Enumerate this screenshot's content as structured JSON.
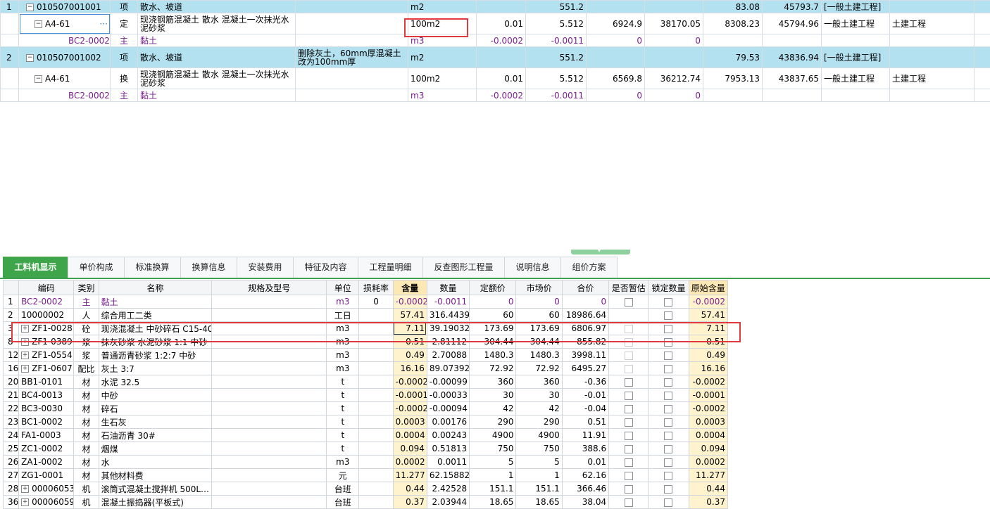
{
  "upper": {
    "rows": [
      {
        "type": "item",
        "hl": true,
        "idx": "1",
        "code": "010507001001",
        "cat": "项",
        "name": "散水、坡道",
        "feature": "",
        "unit": "m2",
        "qty_coef": "",
        "qty": "551.2",
        "price": "",
        "total": "",
        "comp_price": "83.08",
        "comp_total": "45793.7",
        "prof": "[一般土建工程]",
        "spec": ""
      },
      {
        "type": "quota",
        "hl": false,
        "idx": "",
        "code": "A4-61",
        "cat": "定",
        "name": "现浇钢筋混凝土 散水 混凝土一次抹光水泥砂浆",
        "feature": "",
        "unit": "100m2",
        "qty_coef": "0.01",
        "qty": "5.512",
        "price": "6924.9",
        "total": "38170.05",
        "comp_price": "8308.23",
        "comp_total": "45794.96",
        "prof": "一般土建工程",
        "spec": "土建工程"
      },
      {
        "type": "mat",
        "hl": false,
        "idx": "",
        "code": "BC2-0002",
        "cat": "主",
        "name": "黏土",
        "feature": "",
        "unit": "m3",
        "qty_coef": "-0.0002",
        "qty": "-0.0011",
        "price": "0",
        "total": "0",
        "comp_price": "",
        "comp_total": "",
        "prof": "",
        "spec": ""
      },
      {
        "type": "item",
        "hl": true,
        "idx": "2",
        "code": "010507001002",
        "cat": "项",
        "name": "散水、坡道",
        "feature": "删除灰土，60mm厚混凝土改为100mm厚",
        "unit": "m2",
        "qty_coef": "",
        "qty": "551.2",
        "price": "",
        "total": "",
        "comp_price": "79.53",
        "comp_total": "43836.94",
        "prof": "[一般土建工程]",
        "spec": ""
      },
      {
        "type": "quota",
        "hl": false,
        "idx": "",
        "code": "A4-61",
        "cat": "换",
        "name": "现浇钢筋混凝土 散水 混凝土一次抹光水泥砂浆",
        "feature": "",
        "unit": "100m2",
        "qty_coef": "0.01",
        "qty": "5.512",
        "price": "6569.8",
        "total": "36212.74",
        "comp_price": "7953.13",
        "comp_total": "43837.65",
        "prof": "一般土建工程",
        "spec": "土建工程"
      },
      {
        "type": "mat",
        "hl": false,
        "idx": "",
        "code": "BC2-0002",
        "cat": "主",
        "name": "黏土",
        "feature": "",
        "unit": "m3",
        "qty_coef": "-0.0002",
        "qty": "-0.0011",
        "price": "0",
        "total": "0",
        "comp_price": "",
        "comp_total": "",
        "prof": "",
        "spec": ""
      }
    ]
  },
  "tabs": [
    "工料机显示",
    "单价构成",
    "标准换算",
    "换算信息",
    "安装费用",
    "特征及内容",
    "工程量明细",
    "反查图形工程量",
    "说明信息",
    "组价方案"
  ],
  "lower": {
    "headers": [
      "编码",
      "类别",
      "名称",
      "规格及型号",
      "单位",
      "损耗率",
      "含量",
      "数量",
      "定额价",
      "市场价",
      "合价",
      "是否暂估",
      "锁定数量",
      "原始含量"
    ],
    "rows": [
      {
        "rn": "1",
        "code": "BC2-0002",
        "cat": "主",
        "name": "黏土",
        "spec": "",
        "unit": "m3",
        "loss": "0",
        "content": "-0.0002",
        "qty": "-0.0011",
        "qprice": "0",
        "mprice": "0",
        "total": "0",
        "est": "chk",
        "lock": "chk",
        "orig": "-0.0002",
        "purple": true,
        "exp": false
      },
      {
        "rn": "2",
        "code": "10000002",
        "cat": "人",
        "name": "综合用工二类",
        "spec": "",
        "unit": "工日",
        "loss": "",
        "content": "57.41",
        "qty": "316.44392",
        "qprice": "60",
        "mprice": "60",
        "total": "18986.64",
        "est": "",
        "lock": "chk",
        "orig": "57.41",
        "purple": false,
        "exp": false
      },
      {
        "rn": "3",
        "code": "ZF1-0028",
        "cat": "砼",
        "name": "现浇混凝土 中砂碎石 C15-40",
        "spec": "",
        "unit": "m3",
        "loss": "",
        "content": "7.11",
        "qty": "39.19032",
        "qprice": "173.69",
        "mprice": "173.69",
        "total": "6806.97",
        "est": "dim",
        "lock": "chk",
        "orig": "7.11",
        "purple": false,
        "exp": true
      },
      {
        "rn": "8",
        "code": "ZF1-0389",
        "cat": "浆",
        "name": "抹灰砂浆 水泥砂浆 1:1 中砂",
        "spec": "",
        "unit": "m3",
        "loss": "",
        "content": "0.51",
        "qty": "2.81112",
        "qprice": "304.44",
        "mprice": "304.44",
        "total": "855.82",
        "est": "dim",
        "lock": "chk",
        "orig": "0.51",
        "purple": false,
        "exp": true
      },
      {
        "rn": "12",
        "code": "ZF1-0554",
        "cat": "浆",
        "name": "普通沥青砂浆 1:2:7 中砂",
        "spec": "",
        "unit": "m3",
        "loss": "",
        "content": "0.49",
        "qty": "2.70088",
        "qprice": "1480.3",
        "mprice": "1480.3",
        "total": "3998.11",
        "est": "dim",
        "lock": "chk",
        "orig": "0.49",
        "purple": false,
        "exp": true
      },
      {
        "rn": "16",
        "code": "ZF1-0607",
        "cat": "配比",
        "name": "灰土 3:7",
        "spec": "",
        "unit": "m3",
        "loss": "",
        "content": "16.16",
        "qty": "89.07392",
        "qprice": "72.92",
        "mprice": "72.92",
        "total": "6495.27",
        "est": "dim",
        "lock": "chk",
        "orig": "16.16",
        "purple": false,
        "exp": true
      },
      {
        "rn": "20",
        "code": "BB1-0101",
        "cat": "材",
        "name": "水泥 32.5",
        "spec": "",
        "unit": "t",
        "loss": "",
        "content": "-0.0002",
        "qty": "-0.00099",
        "qprice": "360",
        "mprice": "360",
        "total": "-0.36",
        "est": "chk",
        "lock": "chk",
        "orig": "-0.0002",
        "purple": false,
        "exp": false
      },
      {
        "rn": "21",
        "code": "BC4-0013",
        "cat": "材",
        "name": "中砂",
        "spec": "",
        "unit": "t",
        "loss": "",
        "content": "-0.0001",
        "qty": "-0.00033",
        "qprice": "30",
        "mprice": "30",
        "total": "-0.01",
        "est": "chk",
        "lock": "chk",
        "orig": "-0.0001",
        "purple": false,
        "exp": false
      },
      {
        "rn": "22",
        "code": "BC3-0030",
        "cat": "材",
        "name": "碎石",
        "spec": "",
        "unit": "t",
        "loss": "",
        "content": "-0.0002",
        "qty": "-0.00094",
        "qprice": "42",
        "mprice": "42",
        "total": "-0.04",
        "est": "chk",
        "lock": "chk",
        "orig": "-0.0002",
        "purple": false,
        "exp": false
      },
      {
        "rn": "23",
        "code": "BC1-0002",
        "cat": "材",
        "name": "生石灰",
        "spec": "",
        "unit": "t",
        "loss": "",
        "content": "0.0003",
        "qty": "0.00176",
        "qprice": "290",
        "mprice": "290",
        "total": "0.51",
        "est": "chk",
        "lock": "chk",
        "orig": "0.0003",
        "purple": false,
        "exp": false
      },
      {
        "rn": "24",
        "code": "FA1-0003",
        "cat": "材",
        "name": "石油沥青 30#",
        "spec": "",
        "unit": "t",
        "loss": "",
        "content": "0.0004",
        "qty": "0.00243",
        "qprice": "4900",
        "mprice": "4900",
        "total": "11.91",
        "est": "chk",
        "lock": "chk",
        "orig": "0.0004",
        "purple": false,
        "exp": false
      },
      {
        "rn": "25",
        "code": "ZC1-0002",
        "cat": "材",
        "name": "烟煤",
        "spec": "",
        "unit": "t",
        "loss": "",
        "content": "0.094",
        "qty": "0.51813",
        "qprice": "750",
        "mprice": "750",
        "total": "388.6",
        "est": "chk",
        "lock": "chk",
        "orig": "0.094",
        "purple": false,
        "exp": false
      },
      {
        "rn": "26",
        "code": "ZA1-0002",
        "cat": "材",
        "name": "水",
        "spec": "",
        "unit": "m3",
        "loss": "",
        "content": "0.0002",
        "qty": "0.0011",
        "qprice": "5",
        "mprice": "5",
        "total": "0.01",
        "est": "chk",
        "lock": "chk",
        "orig": "0.0002",
        "purple": false,
        "exp": false
      },
      {
        "rn": "27",
        "code": "ZG1-0001",
        "cat": "材",
        "name": "其他材料费",
        "spec": "",
        "unit": "元",
        "loss": "",
        "content": "11.277",
        "qty": "62.15882",
        "qprice": "1",
        "mprice": "1",
        "total": "62.16",
        "est": "chk",
        "lock": "chk",
        "orig": "11.277",
        "purple": false,
        "exp": false
      },
      {
        "rn": "28",
        "code": "00006053",
        "cat": "机",
        "name": "滚筒式混凝土搅拌机 500L…",
        "spec": "",
        "unit": "台班",
        "loss": "",
        "content": "0.44",
        "qty": "2.42528",
        "qprice": "151.1",
        "mprice": "151.1",
        "total": "366.46",
        "est": "chk",
        "lock": "chk",
        "orig": "0.44",
        "purple": false,
        "exp": true
      },
      {
        "rn": "36",
        "code": "00006059",
        "cat": "机",
        "name": "混凝土振捣器(平板式)",
        "spec": "",
        "unit": "台班",
        "loss": "",
        "content": "0.37",
        "qty": "2.03944",
        "qprice": "18.65",
        "mprice": "18.65",
        "total": "38.04",
        "est": "chk",
        "lock": "chk",
        "orig": "0.37",
        "purple": false,
        "exp": true
      }
    ]
  }
}
